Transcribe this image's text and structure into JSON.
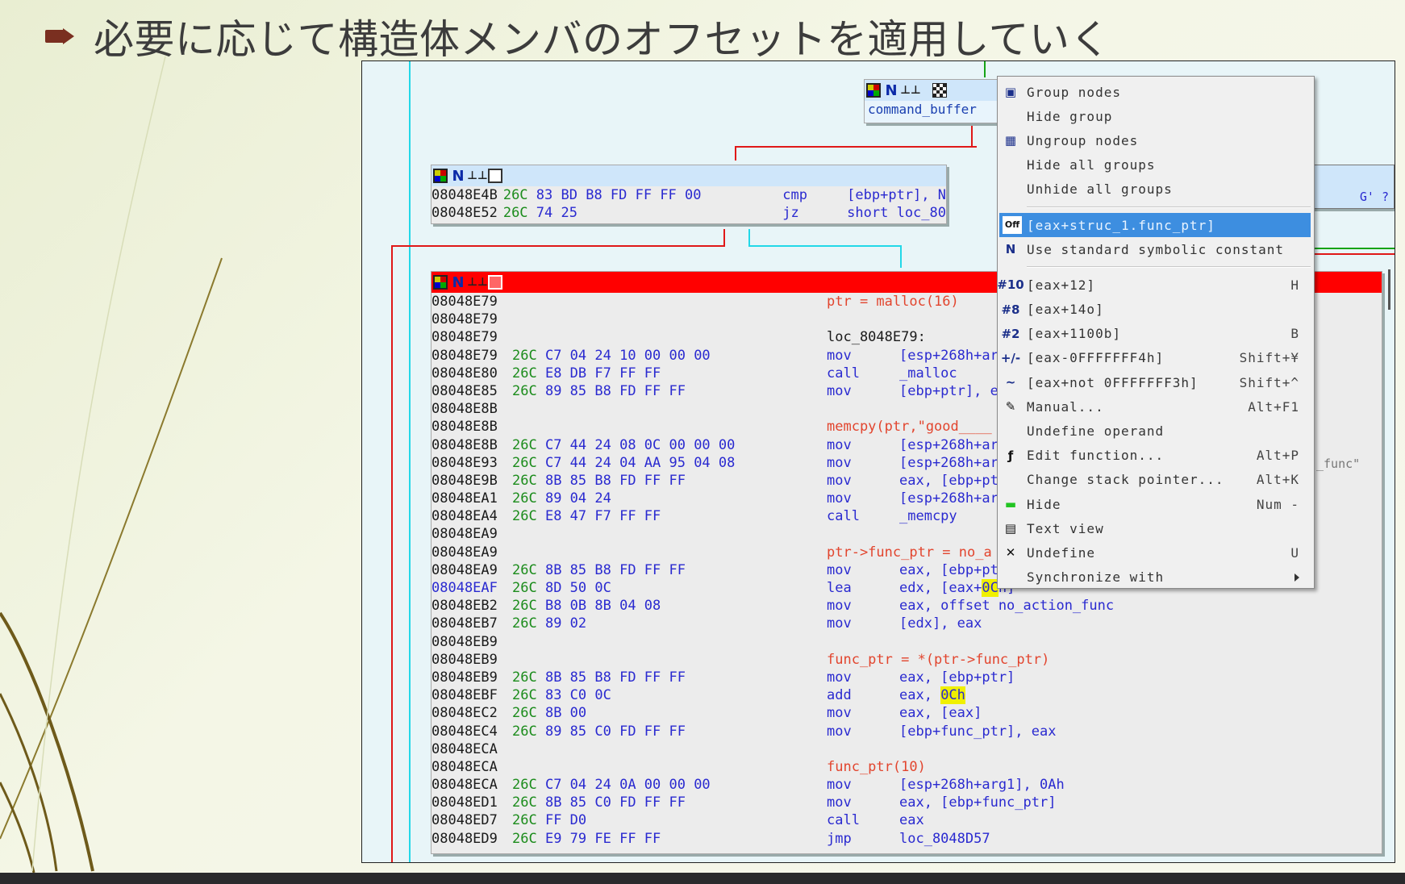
{
  "slide": {
    "title": "必要に応じて構造体メンバのオフセットを適用していく"
  },
  "top_node": {
    "label": "command_buffer"
  },
  "side_labels": {
    "right_top": "G' ?",
    "right_mid": "_func\""
  },
  "block1": {
    "rows": [
      {
        "addr": "08048E4B",
        "bytes": "26C 83 BD B8 FD FF FF 00",
        "mnem": "cmp",
        "ops": "[ebp+ptr], N"
      },
      {
        "addr": "08048E52",
        "bytes": "26C 74 25",
        "mnem": "jz",
        "ops": "short loc_80"
      }
    ]
  },
  "block2": {
    "rows": [
      {
        "addr": "08048E79",
        "bytes": "",
        "mnem": "",
        "ops": "",
        "cmt": "ptr = malloc(16)"
      },
      {
        "addr": "08048E79",
        "bytes": "",
        "mnem": "",
        "ops": "",
        "cmt": ""
      },
      {
        "addr": "08048E79",
        "bytes": "",
        "mnem": "loc_8048E79:",
        "ops": "",
        "cmt": ""
      },
      {
        "addr": "08048E79",
        "bytes": "26C C7 04 24 10 00 00 00",
        "mnem": "mov",
        "ops": "[esp+268h+ar",
        "cmt": ""
      },
      {
        "addr": "08048E80",
        "bytes": "26C E8 DB F7 FF FF",
        "mnem": "call",
        "ops": "_malloc",
        "cmt": ""
      },
      {
        "addr": "08048E85",
        "bytes": "26C 89 85 B8 FD FF FF",
        "mnem": "mov",
        "ops": "[ebp+ptr], e",
        "cmt": ""
      },
      {
        "addr": "08048E8B",
        "bytes": "",
        "mnem": "",
        "ops": "",
        "cmt": ""
      },
      {
        "addr": "08048E8B",
        "bytes": "",
        "mnem": "",
        "ops": "",
        "cmt": "memcpy(ptr,\"good____"
      },
      {
        "addr": "08048E8B",
        "bytes": "26C C7 44 24 08 0C 00 00 00",
        "mnem": "mov",
        "ops": "[esp+268h+ar",
        "cmt": ""
      },
      {
        "addr": "08048E93",
        "bytes": "26C C7 44 24 04 AA 95 04 08",
        "mnem": "mov",
        "ops": "[esp+268h+ar",
        "cmt": ""
      },
      {
        "addr": "08048E9B",
        "bytes": "26C 8B 85 B8 FD FF FF",
        "mnem": "mov",
        "ops": "eax, [ebp+pt",
        "cmt": ""
      },
      {
        "addr": "08048EA1",
        "bytes": "26C 89 04 24",
        "mnem": "mov",
        "ops": "[esp+268h+ar",
        "cmt": ""
      },
      {
        "addr": "08048EA4",
        "bytes": "26C E8 47 F7 FF FF",
        "mnem": "call",
        "ops": "_memcpy",
        "cmt": ""
      },
      {
        "addr": "08048EA9",
        "bytes": "",
        "mnem": "",
        "ops": "",
        "cmt": ""
      },
      {
        "addr": "08048EA9",
        "bytes": "",
        "mnem": "",
        "ops": "",
        "cmt": "ptr->func_ptr = no_a"
      },
      {
        "addr": "08048EA9",
        "bytes": "26C 8B 85 B8 FD FF FF",
        "mnem": "mov",
        "ops": "eax, [ebp+pt",
        "cmt": ""
      },
      {
        "addr": "08048EAF",
        "bytes": "26C 8D 50 0C",
        "mnem": "lea",
        "ops": "edx, [eax+",
        "hl": "0C",
        "ops2": "h]",
        "cmt": "",
        "blue": true
      },
      {
        "addr": "08048EB2",
        "bytes": "26C B8 0B 8B 04 08",
        "mnem": "mov",
        "ops": "eax, offset no_action_func",
        "cmt": ""
      },
      {
        "addr": "08048EB7",
        "bytes": "26C 89 02",
        "mnem": "mov",
        "ops": "[edx], eax",
        "cmt": ""
      },
      {
        "addr": "08048EB9",
        "bytes": "",
        "mnem": "",
        "ops": "",
        "cmt": ""
      },
      {
        "addr": "08048EB9",
        "bytes": "",
        "mnem": "",
        "ops": "",
        "cmt": "func_ptr = *(ptr->func_ptr)"
      },
      {
        "addr": "08048EB9",
        "bytes": "26C 8B 85 B8 FD FF FF",
        "mnem": "mov",
        "ops": "eax, [ebp+ptr]",
        "cmt": ""
      },
      {
        "addr": "08048EBF",
        "bytes": "26C 83 C0 0C",
        "mnem": "add",
        "ops": "eax, ",
        "hl": "0Ch",
        "ops2": "",
        "cmt": ""
      },
      {
        "addr": "08048EC2",
        "bytes": "26C 8B 00",
        "mnem": "mov",
        "ops": "eax, [eax]",
        "cmt": ""
      },
      {
        "addr": "08048EC4",
        "bytes": "26C 89 85 C0 FD FF FF",
        "mnem": "mov",
        "ops": "[ebp+func_ptr], eax",
        "cmt": ""
      },
      {
        "addr": "08048ECA",
        "bytes": "",
        "mnem": "",
        "ops": "",
        "cmt": ""
      },
      {
        "addr": "08048ECA",
        "bytes": "",
        "mnem": "",
        "ops": "",
        "cmt": "func_ptr(10)"
      },
      {
        "addr": "08048ECA",
        "bytes": "26C C7 04 24 0A 00 00 00",
        "mnem": "mov",
        "ops": "[esp+268h+arg1], 0Ah",
        "cmt": ""
      },
      {
        "addr": "08048ED1",
        "bytes": "26C 8B 85 C0 FD FF FF",
        "mnem": "mov",
        "ops": "eax, [ebp+func_ptr]",
        "cmt": ""
      },
      {
        "addr": "08048ED7",
        "bytes": "26C FF D0",
        "mnem": "call",
        "ops": "eax",
        "cmt": ""
      },
      {
        "addr": "08048ED9",
        "bytes": "26C E9 79 FE FF FF",
        "mnem": "jmp",
        "ops": "loc_8048D57",
        "cmt": ""
      }
    ]
  },
  "context_menu": {
    "items": [
      {
        "label": "Group nodes",
        "key": "",
        "icon": "group-nodes-icon",
        "glyph": "▣"
      },
      {
        "label": "Hide group",
        "key": "",
        "icon": "",
        "glyph": ""
      },
      {
        "label": "Ungroup nodes",
        "key": "",
        "icon": "ungroup-nodes-icon",
        "glyph": "▦"
      },
      {
        "label": "Hide all groups",
        "key": "",
        "icon": "",
        "glyph": ""
      },
      {
        "label": "Unhide all groups",
        "key": "",
        "icon": "",
        "glyph": ""
      },
      {
        "sep": true
      },
      {
        "label": "[eax+struc_1.func_ptr]",
        "key": "",
        "icon": "offset-struct-icon",
        "glyph": "Off",
        "selected": true
      },
      {
        "label": "Use standard symbolic constant",
        "key": "",
        "icon": "symbolic-constant-icon",
        "glyph": "N"
      },
      {
        "sep": true
      },
      {
        "label": "[eax+12]",
        "key": "H",
        "icon": "decimal-icon",
        "glyph": "#10"
      },
      {
        "label": "[eax+14o]",
        "key": "",
        "icon": "octal-icon",
        "glyph": "#8"
      },
      {
        "label": "[eax+1100b]",
        "key": "B",
        "icon": "binary-icon",
        "glyph": "#2"
      },
      {
        "label": "[eax-0FFFFFFF4h]",
        "key": "Shift+¥",
        "icon": "negate-icon",
        "glyph": "+/-"
      },
      {
        "label": "[eax+not 0FFFFFFF3h]",
        "key": "Shift+^",
        "icon": "bitwise-not-icon",
        "glyph": "~"
      },
      {
        "label": "Manual...",
        "key": "Alt+F1",
        "icon": "pencil-icon",
        "glyph": "✎"
      },
      {
        "label": "Undefine operand",
        "key": "",
        "icon": "",
        "glyph": ""
      },
      {
        "label": "Edit function...",
        "key": "Alt+P",
        "icon": "function-icon",
        "glyph": "ƒ"
      },
      {
        "label": "Change stack pointer...",
        "key": "Alt+K",
        "icon": "",
        "glyph": ""
      },
      {
        "label": "Hide",
        "key": "Num -",
        "icon": "hide-icon",
        "glyph": "▬"
      },
      {
        "label": "Text view",
        "key": "",
        "icon": "text-view-icon",
        "glyph": "▤"
      },
      {
        "label": "Undefine",
        "key": "U",
        "icon": "undefine-icon",
        "glyph": "✕"
      },
      {
        "label": "Synchronize with",
        "key": "",
        "icon": "",
        "glyph": "",
        "submenu": true
      }
    ]
  },
  "colors": {
    "background": "#f3f5e4",
    "window_bg": "#e8f5f8",
    "header_blue": "#cfe6fa",
    "header_red": "#ff0000",
    "menu_selected": "#3d8ee0",
    "bullet": "#7a2f20"
  }
}
